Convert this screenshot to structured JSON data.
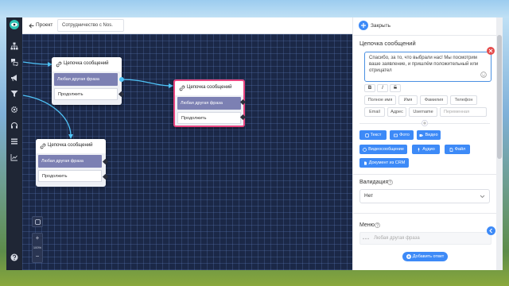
{
  "app": {
    "back_label": "Проект",
    "tab_title": "Сотрудничество с Nos."
  },
  "sidebar": {
    "items": [
      "eye-logo-icon",
      "sitemap-icon",
      "chat-icon",
      "megaphone-icon",
      "filter-icon",
      "gear-icon",
      "support-icon",
      "list-icon",
      "chart-icon",
      "help-icon"
    ]
  },
  "canvas": {
    "nodes": [
      {
        "title": "Цепочка сообщений",
        "phrase": "Любая другая фраза",
        "continue": "Продолжить"
      },
      {
        "title": "Цепочка сообщений",
        "phrase": "Любая другая фраза",
        "continue": "Продолжить"
      },
      {
        "title": "Цепочка сообщений",
        "phrase": "Любая другая фраза",
        "continue": "Продолжить"
      }
    ],
    "zoom_in": "+",
    "zoom_level": "100%",
    "zoom_out": "−"
  },
  "panel": {
    "close_label": "Закрыть",
    "title": "Цепочка сообщений",
    "message": "Спасибо, за то, что выбрали нас! Мы посмотрим ваше заявление, и пришлём положительный или отрицател",
    "format": [
      "B",
      "I",
      "S"
    ],
    "variables": [
      "Полное имя",
      "Имя",
      "Фамилия",
      "Телефон",
      "Email",
      "Адрес",
      "Username"
    ],
    "variable_placeholder": "Переменная",
    "buttons": [
      "Текст",
      "Фото",
      "Видео",
      "Видеосообщение",
      "Аудио",
      "Файл",
      "Документ из CRM"
    ],
    "validation_label": "Валидация",
    "validation_value": "Нет",
    "menu_label": "Меню",
    "menu_placeholder": "Любая другая фраза",
    "add_answer": "Добавить ответ"
  },
  "colors": {
    "accent": "#3d8af7",
    "canvas": "#1b2847",
    "sidebar": "#1f2635",
    "node_phrase": "#7c80b3",
    "selected_border": "#e8457f",
    "edge": "#4fc3f7",
    "danger": "#e54b4b"
  }
}
